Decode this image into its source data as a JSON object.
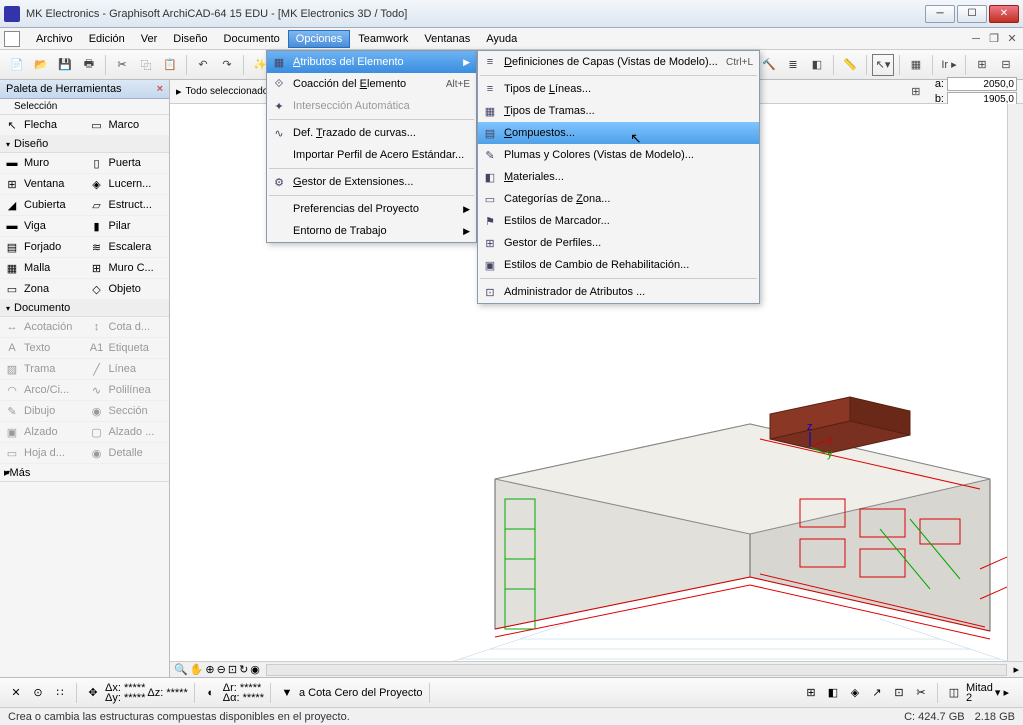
{
  "title": "MK Electronics - Graphisoft ArchiCAD-64 15 EDU - [MK Electronics 3D / Todo]",
  "menus": [
    "Archivo",
    "Edición",
    "Ver",
    "Diseño",
    "Documento",
    "Opciones",
    "Teamwork",
    "Ventanas",
    "Ayuda"
  ],
  "active_menu": "Opciones",
  "menu1": [
    {
      "icon": "▦",
      "label": "Atributos del Elemento",
      "arrow": true,
      "hl": true
    },
    {
      "icon": "⟐",
      "label": "Coacción del Elemento",
      "short": "Alt+E"
    },
    {
      "icon": "✦",
      "label": "Intersección Automática",
      "disabled": true,
      "sep": true
    },
    {
      "icon": "∿",
      "label": "Def. Trazado de curvas..."
    },
    {
      "icon": "",
      "label": "Importar Perfil de Acero Estándar...",
      "sep": true
    },
    {
      "icon": "⚙",
      "label": "Gestor de Extensiones...",
      "sep": true
    },
    {
      "icon": "",
      "label": "Preferencias del Proyecto",
      "arrow": true
    },
    {
      "icon": "",
      "label": "Entorno de Trabajo",
      "arrow": true
    }
  ],
  "menu2": [
    {
      "icon": "≡",
      "label": "Definiciones de Capas (Vistas de Modelo)...",
      "short": "Ctrl+L",
      "sep": true
    },
    {
      "icon": "≡",
      "label": "Tipos de Líneas..."
    },
    {
      "icon": "▦",
      "label": "Tipos de Tramas..."
    },
    {
      "icon": "▤",
      "label": "Compuestos...",
      "hl": true
    },
    {
      "icon": "✎",
      "label": "Plumas y Colores (Vistas de Modelo)..."
    },
    {
      "icon": "◧",
      "label": "Materiales..."
    },
    {
      "icon": "▭",
      "label": "Categorías de Zona..."
    },
    {
      "icon": "⚑",
      "label": "Estilos de Marcador..."
    },
    {
      "icon": "⊞",
      "label": "Gestor de Perfiles..."
    },
    {
      "icon": "▣",
      "label": "Estilos de Cambio de Rehabilitación...",
      "sep": true
    },
    {
      "icon": "⊡",
      "label": "Administrador de Atributos ..."
    }
  ],
  "palette": {
    "title": "Paleta de Herramientas",
    "sub": "Selección",
    "sel_tools": [
      {
        "i": "↖",
        "l": "Flecha"
      },
      {
        "i": "▭",
        "l": "Marco"
      }
    ],
    "design_label": "Diseño",
    "design": [
      {
        "i": "▬",
        "l": "Muro"
      },
      {
        "i": "▯",
        "l": "Puerta"
      },
      {
        "i": "⊞",
        "l": "Ventana"
      },
      {
        "i": "◈",
        "l": "Lucern..."
      },
      {
        "i": "◢",
        "l": "Cubierta"
      },
      {
        "i": "▱",
        "l": "Estruct..."
      },
      {
        "i": "▬",
        "l": "Viga"
      },
      {
        "i": "▮",
        "l": "Pilar"
      },
      {
        "i": "▤",
        "l": "Forjado"
      },
      {
        "i": "≋",
        "l": "Escalera"
      },
      {
        "i": "▦",
        "l": "Malla"
      },
      {
        "i": "⊞",
        "l": "Muro C..."
      },
      {
        "i": "▭",
        "l": "Zona"
      },
      {
        "i": "◇",
        "l": "Objeto"
      }
    ],
    "doc_label": "Documento",
    "doc": [
      {
        "i": "↔",
        "l": "Acotación"
      },
      {
        "i": "↕",
        "l": "Cota d..."
      },
      {
        "i": "A",
        "l": "Texto"
      },
      {
        "i": "A1",
        "l": "Etiqueta"
      },
      {
        "i": "▨",
        "l": "Trama"
      },
      {
        "i": "╱",
        "l": "Línea"
      },
      {
        "i": "◠",
        "l": "Arco/Ci..."
      },
      {
        "i": "∿",
        "l": "Polilínea"
      },
      {
        "i": "✎",
        "l": "Dibujo"
      },
      {
        "i": "◉",
        "l": "Sección"
      },
      {
        "i": "▣",
        "l": "Alzado"
      },
      {
        "i": "▢",
        "l": "Alzado ..."
      },
      {
        "i": "▭",
        "l": "Hoja d..."
      },
      {
        "i": "◉",
        "l": "Detalle"
      }
    ],
    "more": "Más"
  },
  "selbar": {
    "label": "Todo seleccionado"
  },
  "coords": {
    "a": "2050,0",
    "b": "1905,0"
  },
  "bottombar": {
    "dx": "Δx: *****",
    "dy": "Δy: *****",
    "dz": "Δz: *****",
    "dr": "Δr: *****",
    "da": "Δα: *****",
    "snap": "a Cota Cero del Proyecto",
    "scale": "Mitad",
    "scale2": "2"
  },
  "status": {
    "msg": "Crea o cambia las estructuras compuestas disponibles en el proyecto.",
    "disk_c": "C: 424.7 GB",
    "mem": "2.18 GB"
  }
}
